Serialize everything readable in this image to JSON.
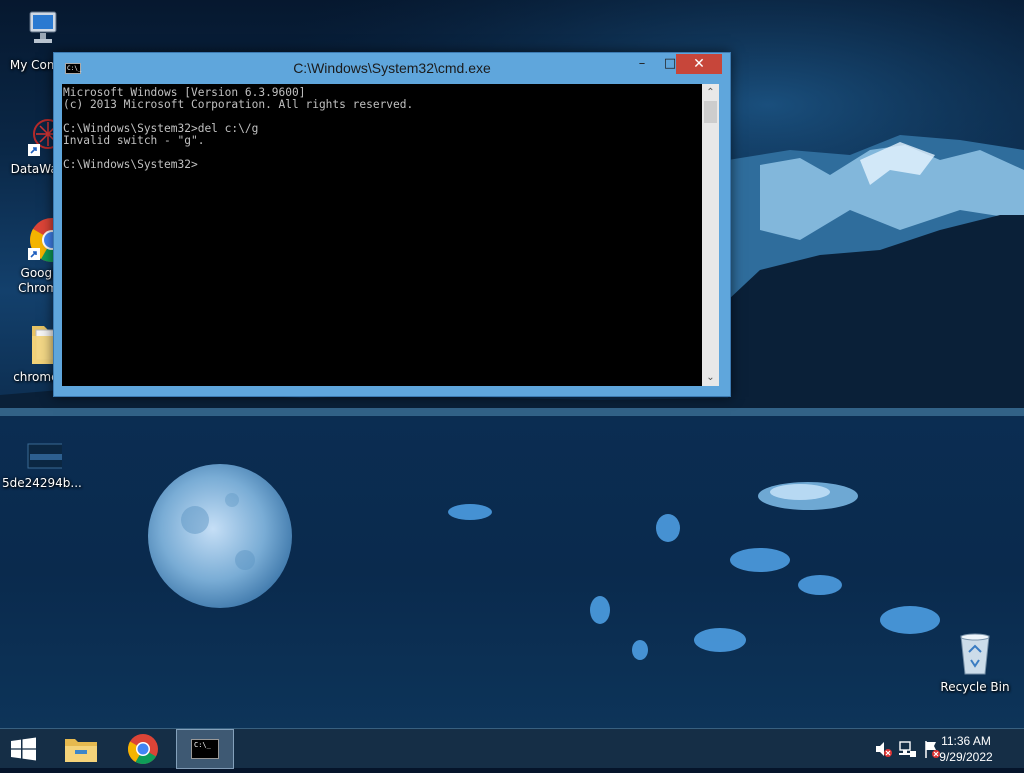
{
  "desktop": {
    "icons": [
      {
        "label": "My Comp",
        "icon": "computer-icon"
      },
      {
        "label": "DataWag",
        "icon": "app-shortcut-icon"
      },
      {
        "label": "Googl",
        "label2": "Chrom",
        "icon": "chrome-icon"
      },
      {
        "label": "chrome-",
        "icon": "folder-icon"
      },
      {
        "label": "5de24294b...",
        "icon": "image-file-icon"
      },
      {
        "label": "Recycle Bin",
        "icon": "recycle-bin-icon"
      }
    ]
  },
  "cmd_window": {
    "title": "C:\\Windows\\System32\\cmd.exe",
    "titlebar_icon_text": "C:\\_",
    "min_glyph": "–",
    "max_glyph": "□",
    "close_glyph": "✕",
    "console_text": "Microsoft Windows [Version 6.3.9600]\n(c) 2013 Microsoft Corporation. All rights reserved.\n\nC:\\Windows\\System32>del c:\\/g\nInvalid switch - \"g\".\n\nC:\\Windows\\System32>",
    "scroll_up_glyph": "⌃",
    "scroll_down_glyph": "⌄"
  },
  "taskbar": {
    "items": [
      {
        "name": "start",
        "icon": "windows-logo-icon"
      },
      {
        "name": "file-explorer",
        "icon": "folder-icon"
      },
      {
        "name": "chrome",
        "icon": "chrome-icon"
      },
      {
        "name": "cmd",
        "icon": "cmd-icon",
        "icon_text": "C:\\_"
      }
    ],
    "tray": {
      "icons": [
        "volume-muted-icon",
        "network-icon",
        "action-center-flag-icon"
      ],
      "time": "11:36 AM",
      "date": "9/29/2022"
    }
  },
  "colors": {
    "title_bar": "#5fa6dc",
    "close_button": "#c7463a",
    "console_bg": "#000000",
    "console_text": "#c0c0c0",
    "taskbar": "#163048"
  }
}
